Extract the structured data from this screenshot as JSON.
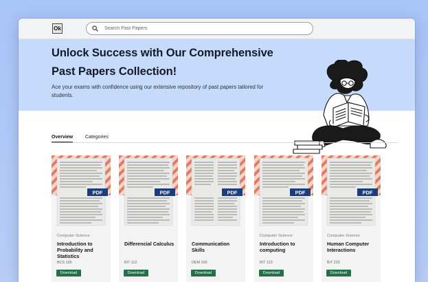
{
  "header": {
    "logo_text": "Ok",
    "search_placeholder": "Search Past Papers"
  },
  "hero": {
    "title": "Unlock Success with Our Comprehensive Past Papers Collection!",
    "subtitle": "Ace your exams with confidence using our extensive repository of past papers tailored for students."
  },
  "tabs": [
    {
      "label": "Overview",
      "active": true
    },
    {
      "label": "Categories",
      "active": false
    }
  ],
  "colors": {
    "accent_green": "#247048",
    "hero_bg": "#c6dafb",
    "pdf_badge": "#1c3d78",
    "stripe_orange": "#f0a89a"
  },
  "cards": [
    {
      "category": "Computer Science",
      "title": "Introduction to Probability and Statistics",
      "code": "BCS 105",
      "badge": "PDF",
      "button": "Download"
    },
    {
      "category": "",
      "title": "Differencial Calculus",
      "code": "BIT 112",
      "badge": "PDF",
      "button": "Download"
    },
    {
      "category": "",
      "title": "Communication Skills",
      "code": "DEM 100",
      "badge": "PDF",
      "button": "Download"
    },
    {
      "category": "Computer Science",
      "title": "Introduction to computing",
      "code": "BIT 123",
      "badge": "PDF",
      "button": "Download"
    },
    {
      "category": "Computer Science",
      "title": "Human Computer Interactions",
      "code": "BIT 220",
      "badge": "PDF",
      "button": "Download"
    }
  ]
}
